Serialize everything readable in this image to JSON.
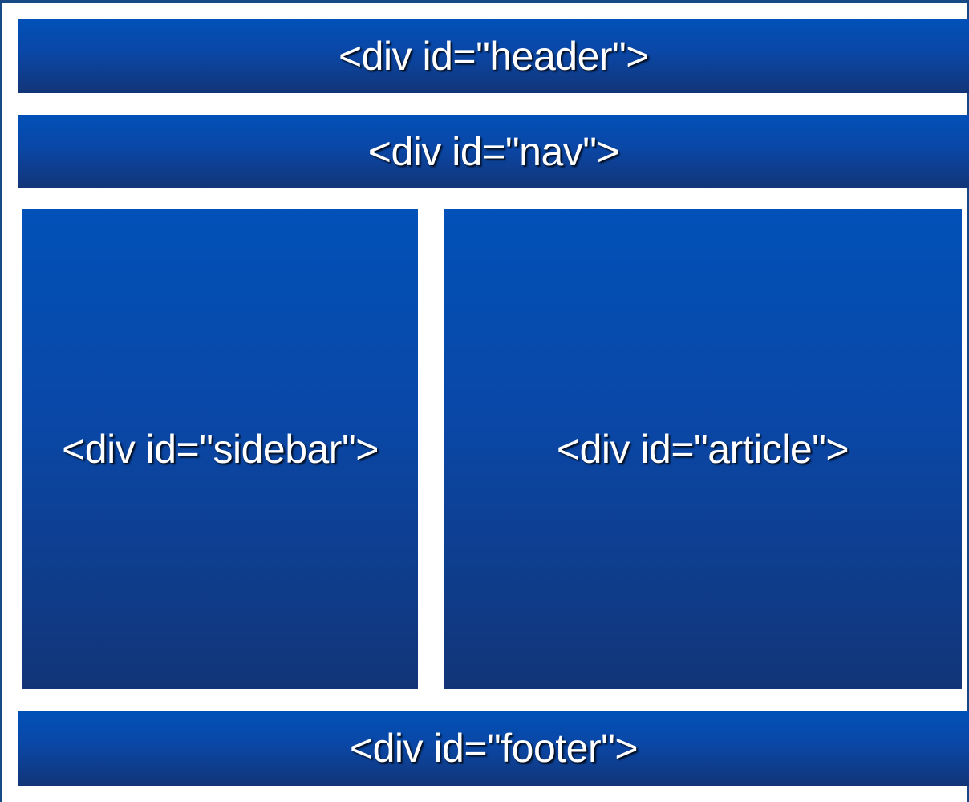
{
  "layout_diagram": {
    "header_label": "<div id=\"header\">",
    "nav_label": "<div id=\"nav\">",
    "sidebar_label": "<div id=\"sidebar\">",
    "article_label": "<div id=\"article\">",
    "footer_label": "<div id=\"footer\">"
  },
  "colors": {
    "block_top": "#0151b8",
    "block_bottom": "#123578",
    "frame_border": "#174a84",
    "text": "#ffffff"
  }
}
